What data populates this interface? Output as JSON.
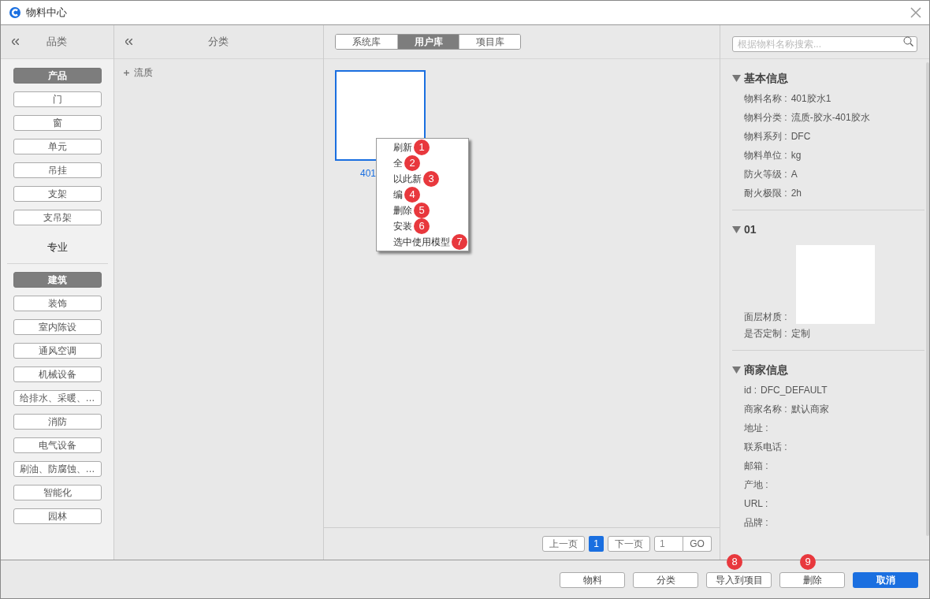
{
  "window": {
    "title": "物料中心"
  },
  "category_panel": {
    "title": "品类",
    "groups": [
      {
        "items": [
          {
            "label": "产品",
            "selected": true
          },
          {
            "label": "门",
            "selected": false
          },
          {
            "label": "窗",
            "selected": false
          },
          {
            "label": "单元",
            "selected": false
          },
          {
            "label": "吊挂",
            "selected": false
          },
          {
            "label": "支架",
            "selected": false
          },
          {
            "label": "支吊架",
            "selected": false
          }
        ]
      },
      {
        "title": "专业",
        "items": [
          {
            "label": "建筑",
            "selected": true
          },
          {
            "label": "装饰",
            "selected": false
          },
          {
            "label": "室内陈设",
            "selected": false
          },
          {
            "label": "通风空调",
            "selected": false
          },
          {
            "label": "机械设备",
            "selected": false
          },
          {
            "label": "给排水、采暖、…",
            "selected": false
          },
          {
            "label": "消防",
            "selected": false
          },
          {
            "label": "电气设备",
            "selected": false
          },
          {
            "label": "刷油、防腐蚀、…",
            "selected": false
          },
          {
            "label": "智能化",
            "selected": false
          },
          {
            "label": "园林",
            "selected": false
          }
        ]
      }
    ]
  },
  "class_panel": {
    "title": "分类",
    "tree": [
      {
        "label": "流质",
        "expanded": false
      }
    ]
  },
  "library_tabs": [
    {
      "label": "系统库",
      "selected": false
    },
    {
      "label": "用户库",
      "selected": true
    },
    {
      "label": "项目库",
      "selected": false
    }
  ],
  "materials": [
    {
      "label": "401",
      "selected": true
    }
  ],
  "context_menu": [
    {
      "label": "刷新",
      "badge": "1"
    },
    {
      "label": "全",
      "badge": "2"
    },
    {
      "label": "以此新",
      "badge": "3"
    },
    {
      "label": "编",
      "badge": "4"
    },
    {
      "label": "删除",
      "badge": "5"
    },
    {
      "label": "安装",
      "badge": "6"
    },
    {
      "label": "选中使用模型",
      "badge": "7"
    }
  ],
  "search": {
    "placeholder": "根据物料名称搜索..."
  },
  "details": [
    {
      "title": "基本信息",
      "expanded": true,
      "fields": [
        {
          "kind": "text",
          "label": "物料名称 :",
          "value": "401胶水1"
        },
        {
          "kind": "text",
          "label": "物料分类 :",
          "value": "流质-胶水-401胶水"
        },
        {
          "kind": "text",
          "label": "物料系列 :",
          "value": "DFC"
        },
        {
          "kind": "text",
          "label": "物料单位 :",
          "value": "kg"
        },
        {
          "kind": "text",
          "label": "防火等级 :",
          "value": "A"
        },
        {
          "kind": "text",
          "label": "耐火极限 :",
          "value": "2h"
        }
      ]
    },
    {
      "title": "01",
      "expanded": true,
      "fields": [
        {
          "kind": "image",
          "label": "面层材质 :"
        },
        {
          "kind": "text",
          "label": "是否定制 :",
          "value": "定制"
        }
      ]
    },
    {
      "title": "商家信息",
      "expanded": true,
      "fields": [
        {
          "kind": "text",
          "label": "id :",
          "value": "DFC_DEFAULT"
        },
        {
          "kind": "text",
          "label": "商家名称 :",
          "value": "默认商家"
        },
        {
          "kind": "text",
          "label": "地址 :"
        },
        {
          "kind": "text",
          "label": "联系电话 :"
        },
        {
          "kind": "text",
          "label": "邮箱 :"
        },
        {
          "kind": "text",
          "label": "产地 :"
        },
        {
          "kind": "text",
          "label": "URL :"
        },
        {
          "kind": "text",
          "label": "品牌 :"
        }
      ]
    }
  ],
  "pagination": {
    "prev": "上一页",
    "pages": [
      {
        "label": "1",
        "selected": true
      }
    ],
    "next": "下一页",
    "goto": "1",
    "go": "GO"
  },
  "footer_buttons": [
    {
      "label": "物料",
      "kind": "default"
    },
    {
      "label": "分类",
      "kind": "default"
    },
    {
      "label": "导入到项目",
      "kind": "default",
      "badge": "8"
    },
    {
      "label": "删除",
      "kind": "default",
      "badge": "9"
    },
    {
      "label": "取消",
      "kind": "primary"
    }
  ]
}
